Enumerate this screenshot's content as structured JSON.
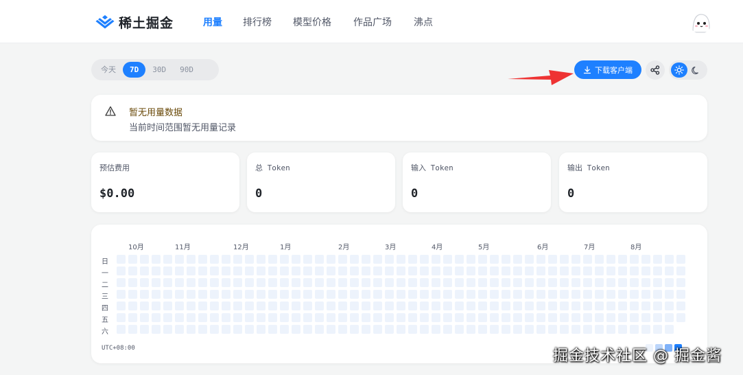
{
  "brand": {
    "name": "稀土掘金",
    "color": "#1e80ff"
  },
  "nav": {
    "items": [
      {
        "label": "用量",
        "active": true
      },
      {
        "label": "排行榜",
        "active": false
      },
      {
        "label": "模型价格",
        "active": false
      },
      {
        "label": "作品广场",
        "active": false
      },
      {
        "label": "沸点",
        "active": false
      }
    ]
  },
  "range": {
    "options": [
      "今天",
      "7D",
      "30D",
      "90D"
    ],
    "selected": "7D"
  },
  "toolbar": {
    "download_label": "下载客户端",
    "download_icon": "download-icon",
    "share_icon": "share-icon",
    "theme_light_icon": "sun-icon",
    "theme_dark_icon": "moon-icon",
    "theme_selected": "light"
  },
  "alert": {
    "title": "暂无用量数据",
    "description": "当前时间范围暂无用量记录",
    "icon": "warning-icon"
  },
  "stats": [
    {
      "label": "预估费用",
      "value": "$0.00"
    },
    {
      "label": "总 Token",
      "value": "0"
    },
    {
      "label": "输入 Token",
      "value": "0"
    },
    {
      "label": "输出 Token",
      "value": "0"
    }
  ],
  "heatmap": {
    "months": [
      "10月",
      "11月",
      "12月",
      "1月",
      "2月",
      "3月",
      "4月",
      "5月",
      "6月",
      "7月",
      "8月"
    ],
    "weekdays": [
      "日",
      "一",
      "二",
      "三",
      "四",
      "五",
      "六"
    ],
    "timezone": "UTC+08:00",
    "empty_color": "#edf3fc"
  },
  "watermark": "掘金技术社区 @ 掘金酱"
}
